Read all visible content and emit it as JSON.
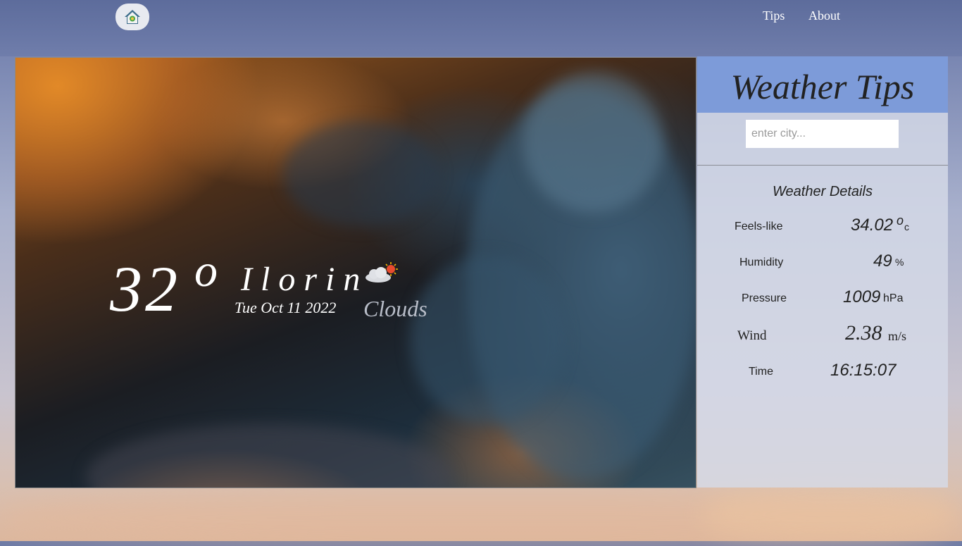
{
  "nav": {
    "tips_label": "Tips",
    "about_label": "About"
  },
  "hero": {
    "temperature": "32",
    "degree_symbol": "o",
    "city": "Ilorin",
    "date": "Tue Oct 11 2022",
    "condition": "Clouds",
    "condition_icon": "cloud-sun-icon"
  },
  "panel": {
    "title": "Weather Tips",
    "search_placeholder": "enter city...",
    "details_title": "Weather Details",
    "details": {
      "feels_like": {
        "label": "Feels-like",
        "value": "34.02",
        "sup": "o",
        "unit": "c"
      },
      "humidity": {
        "label": "Humidity",
        "value": "49",
        "unit": "%"
      },
      "pressure": {
        "label": "Pressure",
        "value": "1009",
        "unit": "hPa"
      },
      "wind": {
        "label": "Wind",
        "value": "2.38",
        "unit": "m/s"
      },
      "time": {
        "label": "Time",
        "value": "16:15:07"
      }
    }
  },
  "colors": {
    "topbar": "#5c6b9b",
    "panel_header": "#7d9bd9",
    "condition_text": "#b8bdc8"
  }
}
